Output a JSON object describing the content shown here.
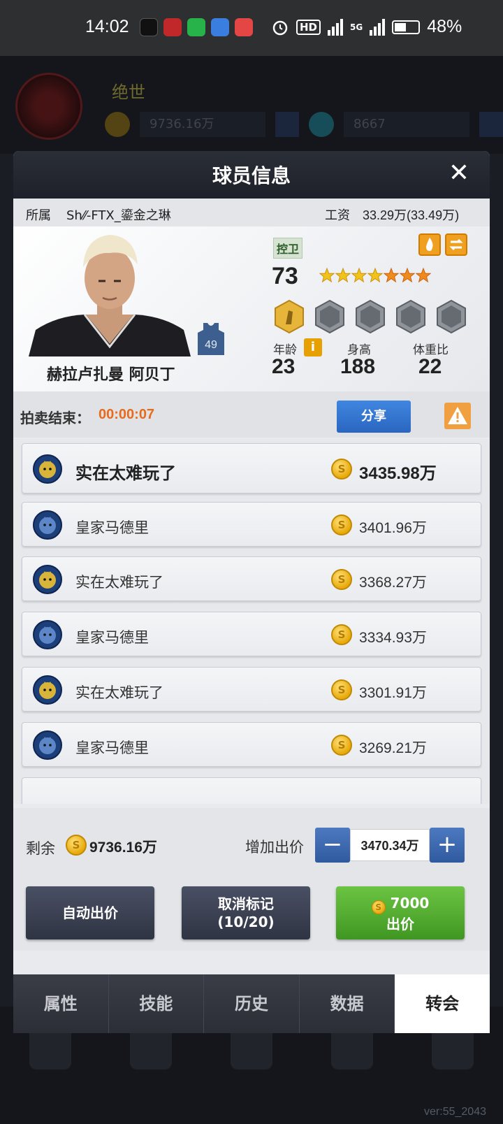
{
  "status_bar": {
    "time": "14:02",
    "battery": "48%",
    "network_1": "5G",
    "network_2": "5G",
    "hd": "HD"
  },
  "background": {
    "player_name": "绝世",
    "coins": "9736.16万",
    "gems": "8667"
  },
  "modal": {
    "title": "球员信息",
    "close_label": "✕"
  },
  "info": {
    "owner_label": "所属",
    "owner_value": "Sh⁄⁄-FTX_鎏金之琳",
    "salary_label": "工资",
    "salary_value": "33.29万(33.49万)"
  },
  "player": {
    "name": "赫拉卢扎曼 阿贝丁",
    "position": "控卫",
    "rating": "73",
    "stars_gold": 4,
    "stars_orange": 3,
    "jersey_number": "49",
    "age_label": "年龄",
    "age": "23",
    "height_label": "身高",
    "height": "188",
    "weight_label": "体重比",
    "weight": "22",
    "info_icon": "i"
  },
  "auction": {
    "label": "拍卖结束：",
    "time": "00:00:07",
    "share_label": "分享"
  },
  "bids": [
    {
      "team": "实在太难玩了",
      "amount": "3435.98万",
      "logo": "tiger"
    },
    {
      "team": "皇家马德里",
      "amount": "3401.96万",
      "logo": "wolf"
    },
    {
      "team": "实在太难玩了",
      "amount": "3368.27万",
      "logo": "tiger"
    },
    {
      "team": "皇家马德里",
      "amount": "3334.93万",
      "logo": "wolf"
    },
    {
      "team": "实在太难玩了",
      "amount": "3301.91万",
      "logo": "tiger"
    },
    {
      "team": "皇家马德里",
      "amount": "3269.21万",
      "logo": "wolf"
    }
  ],
  "footer": {
    "remain_label": "剩余",
    "remain_value": "9736.16万",
    "raise_label": "增加出价",
    "raise_value": "3470.34万",
    "minus": "−",
    "plus": "+",
    "auto_bid": "自动出价",
    "unmark_l1": "取消标记",
    "unmark_l2": "(10/20)",
    "bid_amount": "7000",
    "bid_label": "出价",
    "coin_symbol": "S"
  },
  "tabs": [
    {
      "label": "属性"
    },
    {
      "label": "技能"
    },
    {
      "label": "历史"
    },
    {
      "label": "数据"
    },
    {
      "label": "转会"
    }
  ],
  "version": "ver:55_2043"
}
